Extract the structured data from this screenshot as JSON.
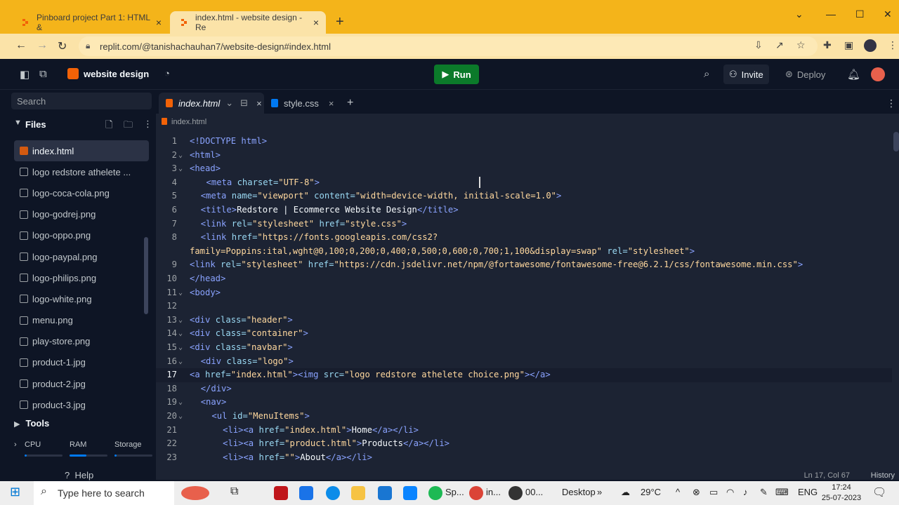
{
  "browser": {
    "tabs": [
      {
        "title": "Pinboard project Part 1: HTML &",
        "active": false
      },
      {
        "title": "index.html - website design - Re",
        "active": true
      }
    ],
    "url": "replit.com/@tanishachauhan7/website-design#index.html"
  },
  "replit_header": {
    "project_name": "website design",
    "run_label": "Run",
    "invite_label": "Invite",
    "deploy_label": "Deploy"
  },
  "sidebar": {
    "search_placeholder": "Search",
    "files_label": "Files",
    "files": [
      "index.html",
      "logo redstore athelete ...",
      "logo-coca-cola.png",
      "logo-godrej.png",
      "logo-oppo.png",
      "logo-paypal.png",
      "logo-philips.png",
      "logo-white.png",
      "menu.png",
      "play-store.png",
      "product-1.jpg",
      "product-2.jpg",
      "product-3.jpg"
    ],
    "tools_label": "Tools",
    "resources": {
      "cpu": "CPU",
      "ram": "RAM",
      "storage": "Storage",
      "cpu_level": 0.05,
      "ram_level": 0.45,
      "storage_level": 0.05
    },
    "help_label": "Help"
  },
  "editor": {
    "tabs": [
      "index.html",
      "style.css"
    ],
    "breadcrumb": "index.html",
    "status": "Ln 17, Col 67",
    "history_label": "History",
    "lines": [
      {
        "n": "1",
        "f": "",
        "i": 0,
        "t": [
          [
            "tg",
            "<!DOCTYPE html>"
          ]
        ]
      },
      {
        "n": "2",
        "f": "v",
        "i": 0,
        "t": [
          [
            "tg",
            "<html>"
          ]
        ]
      },
      {
        "n": "3",
        "f": "v",
        "i": 0,
        "t": [
          [
            "tg",
            "<head>"
          ]
        ]
      },
      {
        "n": "4",
        "f": "",
        "i": 3,
        "t": [
          [
            "tg",
            "<meta "
          ],
          [
            "at",
            "charset="
          ],
          [
            "st",
            "\"UTF-8\""
          ],
          [
            "tg",
            ">"
          ]
        ]
      },
      {
        "n": "5",
        "f": "",
        "i": 2,
        "t": [
          [
            "tg",
            "<meta "
          ],
          [
            "at",
            "name="
          ],
          [
            "st",
            "\"viewport\" "
          ],
          [
            "at",
            "content="
          ],
          [
            "st",
            "\"width=device-width, initial-scale=1.0\""
          ],
          [
            "tg",
            ">"
          ]
        ]
      },
      {
        "n": "6",
        "f": "",
        "i": 2,
        "t": [
          [
            "tg",
            "<title>"
          ],
          [
            "tx",
            "Redstore | Ecommerce Website Design"
          ],
          [
            "tg",
            "</title>"
          ]
        ]
      },
      {
        "n": "7",
        "f": "",
        "i": 2,
        "t": [
          [
            "tg",
            "<link "
          ],
          [
            "at",
            "rel="
          ],
          [
            "st",
            "\"stylesheet\" "
          ],
          [
            "at",
            "href="
          ],
          [
            "st",
            "\"style.css\""
          ],
          [
            "tg",
            ">"
          ]
        ]
      },
      {
        "n": "8",
        "f": "",
        "i": 2,
        "t": [
          [
            "tg",
            "<link "
          ],
          [
            "at",
            "href="
          ],
          [
            "st",
            "\"https://fonts.googleapis.com/css2?"
          ]
        ]
      },
      {
        "n": "",
        "f": "",
        "i": 0,
        "t": [
          [
            "st",
            "family=Poppins:ital,wght@0,100;0,200;0,400;0,500;0,600;0,700;1,100&display=swap\" "
          ],
          [
            "at",
            "rel="
          ],
          [
            "st",
            "\"stylesheet\""
          ],
          [
            "tg",
            ">"
          ]
        ]
      },
      {
        "n": "9",
        "f": "",
        "i": 0,
        "t": [
          [
            "tg",
            "<link "
          ],
          [
            "at",
            "rel="
          ],
          [
            "st",
            "\"stylesheet\" "
          ],
          [
            "at",
            "href="
          ],
          [
            "st",
            "\"https://cdn.jsdelivr.net/npm/@fortawesome/fontawesome-free@6.2.1/css/fontawesome.min.css\""
          ],
          [
            "tg",
            ">"
          ]
        ]
      },
      {
        "n": "10",
        "f": "",
        "i": 0,
        "t": [
          [
            "tg",
            "</head>"
          ]
        ]
      },
      {
        "n": "11",
        "f": "v",
        "i": 0,
        "t": [
          [
            "tg",
            "<body>"
          ]
        ]
      },
      {
        "n": "12",
        "f": "",
        "i": 0,
        "t": []
      },
      {
        "n": "13",
        "f": "v",
        "i": 0,
        "t": [
          [
            "tg",
            "<div "
          ],
          [
            "at",
            "class="
          ],
          [
            "st",
            "\"header\""
          ],
          [
            "tg",
            ">"
          ]
        ]
      },
      {
        "n": "14",
        "f": "v",
        "i": 0,
        "t": [
          [
            "tg",
            "<div "
          ],
          [
            "at",
            "class="
          ],
          [
            "st",
            "\"container\""
          ],
          [
            "tg",
            ">"
          ]
        ]
      },
      {
        "n": "15",
        "f": "v",
        "i": 0,
        "t": [
          [
            "tg",
            "<div "
          ],
          [
            "at",
            "class="
          ],
          [
            "st",
            "\"navbar\""
          ],
          [
            "tg",
            ">"
          ]
        ]
      },
      {
        "n": "16",
        "f": "v",
        "i": 2,
        "t": [
          [
            "tg",
            "<div "
          ],
          [
            "at",
            "class="
          ],
          [
            "st",
            "\"logo\""
          ],
          [
            "tg",
            ">"
          ]
        ]
      },
      {
        "n": "17",
        "f": "",
        "i": 0,
        "cur": true,
        "t": [
          [
            "tg",
            "<a "
          ],
          [
            "at",
            "href="
          ],
          [
            "st",
            "\"index.html\""
          ],
          [
            "tg",
            "><img "
          ],
          [
            "at",
            "src="
          ],
          [
            "st",
            "\"logo redstore athelete choice.png\""
          ],
          [
            "tg",
            "></a>"
          ]
        ]
      },
      {
        "n": "18",
        "f": "",
        "i": 2,
        "t": [
          [
            "tg",
            "</div>"
          ]
        ]
      },
      {
        "n": "19",
        "f": "v",
        "i": 2,
        "t": [
          [
            "tg",
            "<nav>"
          ]
        ]
      },
      {
        "n": "20",
        "f": "v",
        "i": 4,
        "t": [
          [
            "tg",
            "<ul "
          ],
          [
            "at",
            "id="
          ],
          [
            "st",
            "\"MenuItems\""
          ],
          [
            "tg",
            ">"
          ]
        ]
      },
      {
        "n": "21",
        "f": "",
        "i": 6,
        "t": [
          [
            "tg",
            "<li><a "
          ],
          [
            "at",
            "href="
          ],
          [
            "st",
            "\"index.html\""
          ],
          [
            "tg",
            ">"
          ],
          [
            "tx",
            "Home"
          ],
          [
            "tg",
            "</a></li>"
          ]
        ]
      },
      {
        "n": "22",
        "f": "",
        "i": 6,
        "t": [
          [
            "tg",
            "<li><a "
          ],
          [
            "at",
            "href="
          ],
          [
            "st",
            "\"product.html\""
          ],
          [
            "tg",
            ">"
          ],
          [
            "tx",
            "Products"
          ],
          [
            "tg",
            "</a></li>"
          ]
        ]
      },
      {
        "n": "23",
        "f": "",
        "i": 6,
        "t": [
          [
            "tg",
            "<li><a "
          ],
          [
            "at",
            "href="
          ],
          [
            "st",
            "\"\""
          ],
          [
            "tg",
            ">"
          ],
          [
            "tx",
            "About"
          ],
          [
            "tg",
            "</a></li>"
          ]
        ]
      }
    ]
  },
  "taskbar": {
    "search_placeholder": "Type here to search",
    "items": [
      "Sp...",
      "in...",
      "00..."
    ],
    "desktop_label": "Desktop",
    "weather": "29°C",
    "language": "ENG",
    "time": "17:24",
    "date": "25-07-2023"
  }
}
